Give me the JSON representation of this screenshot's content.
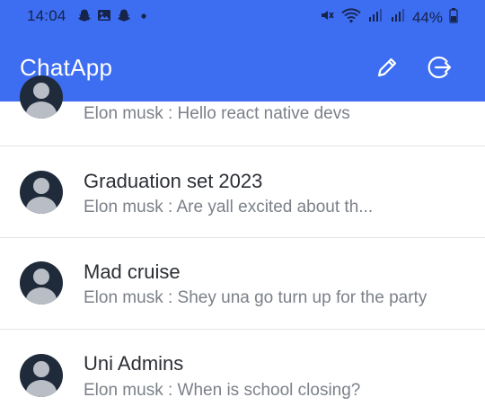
{
  "status_bar": {
    "time": "14:04",
    "battery": "44%",
    "notification_icons": [
      "snapchat-icon",
      "image-icon",
      "snapchat-icon",
      "dot-icon"
    ],
    "system_icons": [
      "mute-icon",
      "wifi-icon",
      "signal-icon",
      "signal-icon",
      "battery-icon"
    ]
  },
  "header": {
    "title": "ChatApp",
    "edit_icon": "pencil-icon",
    "logout_icon": "logout-icon",
    "background": "#3d6df0"
  },
  "chats": [
    {
      "name": "",
      "preview": "Elon musk : Hello react native devs"
    },
    {
      "name": "Graduation set 2023",
      "preview": "Elon musk : Are yall excited about th..."
    },
    {
      "name": "Mad cruise",
      "preview": "Elon musk : Shey una go turn up for the party"
    },
    {
      "name": "Uni Admins",
      "preview": "Elon musk : When is school closing?"
    }
  ]
}
